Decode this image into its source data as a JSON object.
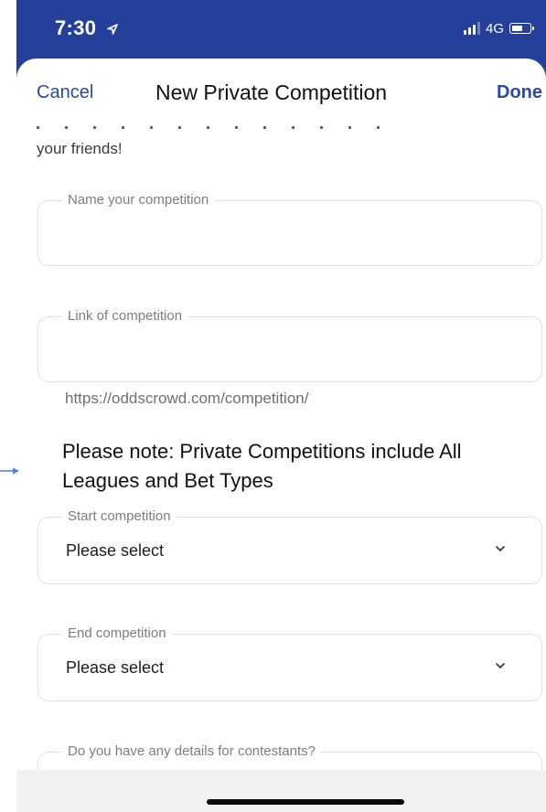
{
  "status_bar": {
    "time": "7:30",
    "network": "4G",
    "location_icon": "location-arrow-icon",
    "signal_icon": "signal-bars-icon",
    "battery_icon": "battery-icon"
  },
  "header": {
    "cancel_label": "Cancel",
    "title": "New Private Competition",
    "done_label": "Done"
  },
  "intro": {
    "text": "your friends!"
  },
  "fields": {
    "name": {
      "label": "Name your competition",
      "value": ""
    },
    "link": {
      "label": "Link of competition",
      "value": "",
      "helper": "https://oddscrowd.com/competition/"
    },
    "note": "Please note: Private Competitions include All Leagues and Bet Types",
    "start": {
      "label": "Start competition",
      "value": "Please select"
    },
    "end": {
      "label": "End competition",
      "value": "Please select"
    },
    "details": {
      "label": "Do you have any details for contestants?"
    }
  },
  "colors": {
    "header_band": "#24409a",
    "nav_accent": "#2b4a9e",
    "annotation_arrow": "#4a7fd4"
  }
}
